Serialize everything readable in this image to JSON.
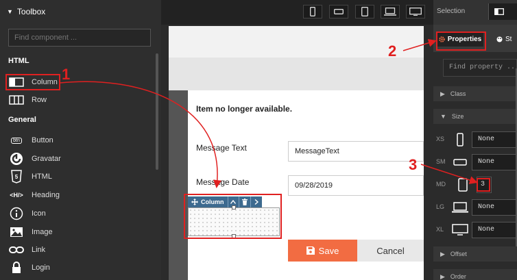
{
  "toolbox": {
    "title": "Toolbox",
    "search_placeholder": "Find component ...",
    "sections": {
      "html": "HTML",
      "general": "General"
    },
    "html_items": [
      {
        "label": "Column",
        "icon": "column-icon"
      },
      {
        "label": "Row",
        "icon": "row-icon"
      }
    ],
    "general_items": [
      {
        "label": "Button",
        "icon": "btn-icon",
        "icon_text": "btn"
      },
      {
        "label": "Gravatar",
        "icon": "gravatar-icon"
      },
      {
        "label": "HTML",
        "icon": "html5-icon"
      },
      {
        "label": "Heading",
        "icon": "heading-icon",
        "icon_text": "<H/>"
      },
      {
        "label": "Icon",
        "icon": "info-icon"
      },
      {
        "label": "Image",
        "icon": "image-icon"
      },
      {
        "label": "Link",
        "icon": "link-icon"
      },
      {
        "label": "Login",
        "icon": "lock-icon"
      }
    ]
  },
  "device_bar": {
    "buttons": [
      "phone-portrait",
      "phone-landscape",
      "tablet-portrait",
      "laptop",
      "desktop"
    ]
  },
  "canvas": {
    "message": "Item no longer available.",
    "fields": [
      {
        "label": "Message Text",
        "value": "MessageText"
      },
      {
        "label": "Message Date",
        "value": "09/28/2019"
      }
    ],
    "column_toolbar": {
      "label": "Column"
    },
    "save_label": "Save",
    "cancel_label": "Cancel"
  },
  "right_panel": {
    "selection_label": "Selection",
    "tabs": {
      "properties": "Properties",
      "styles": "St"
    },
    "find_placeholder": "Find property ...",
    "groups": {
      "class": "Class",
      "size": "Size",
      "offset": "Offset",
      "order": "Order"
    },
    "sizes": [
      {
        "bp": "XS",
        "value": "None",
        "icon": "phone-icon"
      },
      {
        "bp": "SM",
        "value": "None",
        "icon": "phone-landscape-icon"
      },
      {
        "bp": "MD",
        "value": "3",
        "icon": "tablet-icon"
      },
      {
        "bp": "LG",
        "value": "None",
        "icon": "laptop-icon"
      },
      {
        "bp": "XL",
        "value": "None",
        "icon": "monitor-icon"
      }
    ]
  },
  "annotations": {
    "step1": "1",
    "step2": "2",
    "step3": "3"
  },
  "colors": {
    "accent_red": "#e02020",
    "save": "#f26c42",
    "column_bar": "#3d6a8f"
  }
}
